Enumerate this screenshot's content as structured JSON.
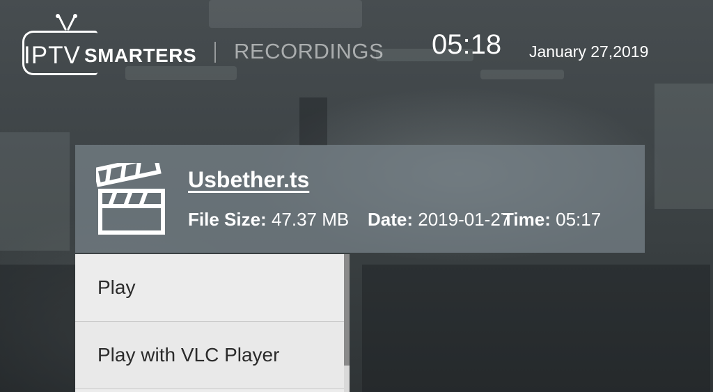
{
  "header": {
    "logo_iptv": "IPTV",
    "logo_smarters": "SMARTERS",
    "section_title": "RECORDINGS",
    "time": "05:18",
    "date": "January 27,2019"
  },
  "recording": {
    "icon": "clapperboard-icon",
    "file_name": "Usbether.ts",
    "file_size_label": "File Size:",
    "file_size_value": "47.37 MB",
    "date_label": "Date:",
    "date_value": "2019-01-27",
    "time_label": "Time:",
    "time_value": "05:17"
  },
  "menu": {
    "items": [
      {
        "label": "Play"
      },
      {
        "label": "Play with VLC Player"
      }
    ]
  },
  "colors": {
    "panel_overlay": "#788a8f",
    "menu_bg": "#ececec",
    "text_primary": "#ffffff"
  }
}
